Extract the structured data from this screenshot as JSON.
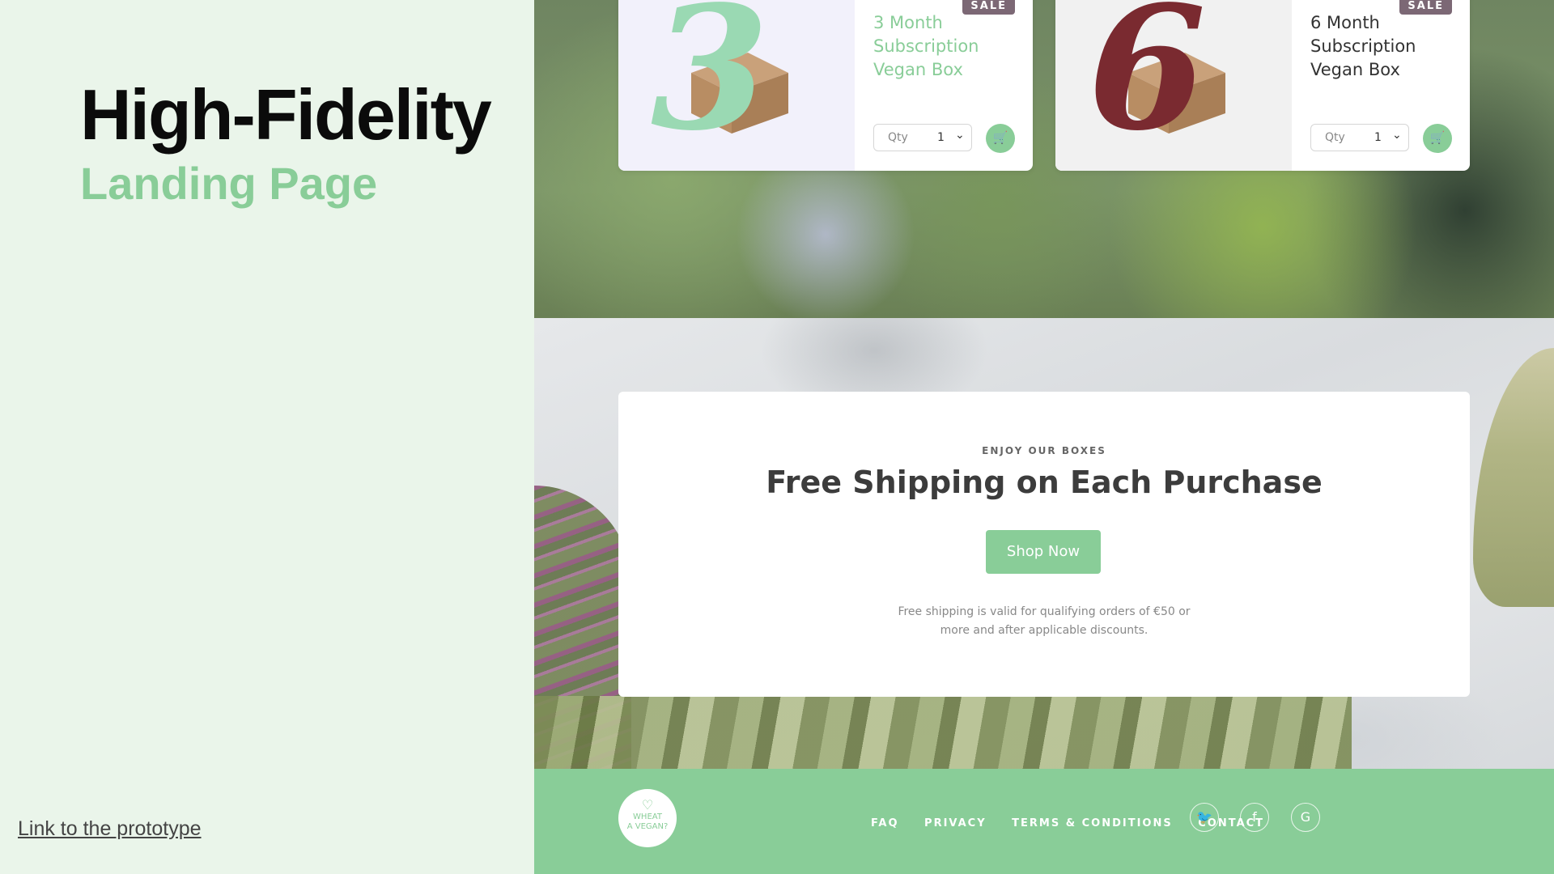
{
  "left_panel": {
    "title": "High-Fidelity",
    "subtitle": "Landing Page",
    "prototype_link": "Link to the prototype"
  },
  "colors": {
    "accent_green": "#89cd98",
    "sale_badge": "#7c6875",
    "left_bg": "#eaf5ea"
  },
  "products": [
    {
      "numeral": "3",
      "name": "3 Month Subscription Vegan Box",
      "badge": "SALE",
      "qty_label": "Qty",
      "qty_value": "1",
      "name_color": "#89cd98",
      "numeral_color": "#9ad9b3",
      "image_bg": "#f2f1fb"
    },
    {
      "numeral": "6",
      "name": "6 Month Subscription Vegan Box",
      "badge": "SALE",
      "qty_label": "Qty",
      "qty_value": "1",
      "name_color": "#333333",
      "numeral_color": "#7a2a30",
      "image_bg": "#f1f1f1"
    }
  ],
  "promo": {
    "eyebrow": "ENJOY OUR BOXES",
    "headline": "Free Shipping on Each Purchase",
    "button": "Shop Now",
    "fine_print": "Free shipping is valid for qualifying orders of €50 or more and after applicable discounts."
  },
  "footer": {
    "logo_line1": "WHEAT",
    "logo_line2": "A VEGAN?",
    "nav": [
      "FAQ",
      "PRIVACY",
      "TERMS & CONDITIONS",
      "CONTACT"
    ],
    "social": [
      "twitter-icon",
      "facebook-icon",
      "google-icon"
    ]
  }
}
